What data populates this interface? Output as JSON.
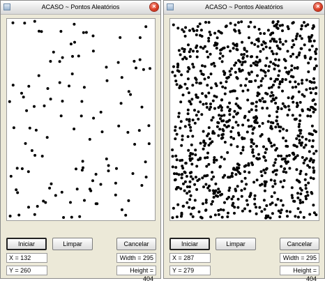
{
  "windows": [
    {
      "title": "ACASO ~ Pontos Aleatórios",
      "buttons": {
        "start": "Iniciar",
        "clear": "Limpar",
        "cancel": "Cancelar"
      },
      "readouts": {
        "x": "X = 132",
        "y": "Y = 260",
        "width": "Width = 295",
        "height": "Height = 404"
      },
      "points": {
        "count": 120,
        "seed": 7
      }
    },
    {
      "title": "ACASO ~ Pontos Aleatórios",
      "buttons": {
        "start": "Iniciar",
        "clear": "Limpar",
        "cancel": "Cancelar"
      },
      "readouts": {
        "x": "X = 287",
        "y": "Y = 279",
        "width": "Width = 295",
        "height": "Height = 404"
      },
      "points": {
        "count": 1000,
        "seed": 42
      }
    }
  ],
  "icons": {
    "app": "app-icon",
    "close": "close-icon"
  },
  "colors": {
    "dot": "#000000",
    "canvas": "#ffffff",
    "close": "#d7381f"
  }
}
